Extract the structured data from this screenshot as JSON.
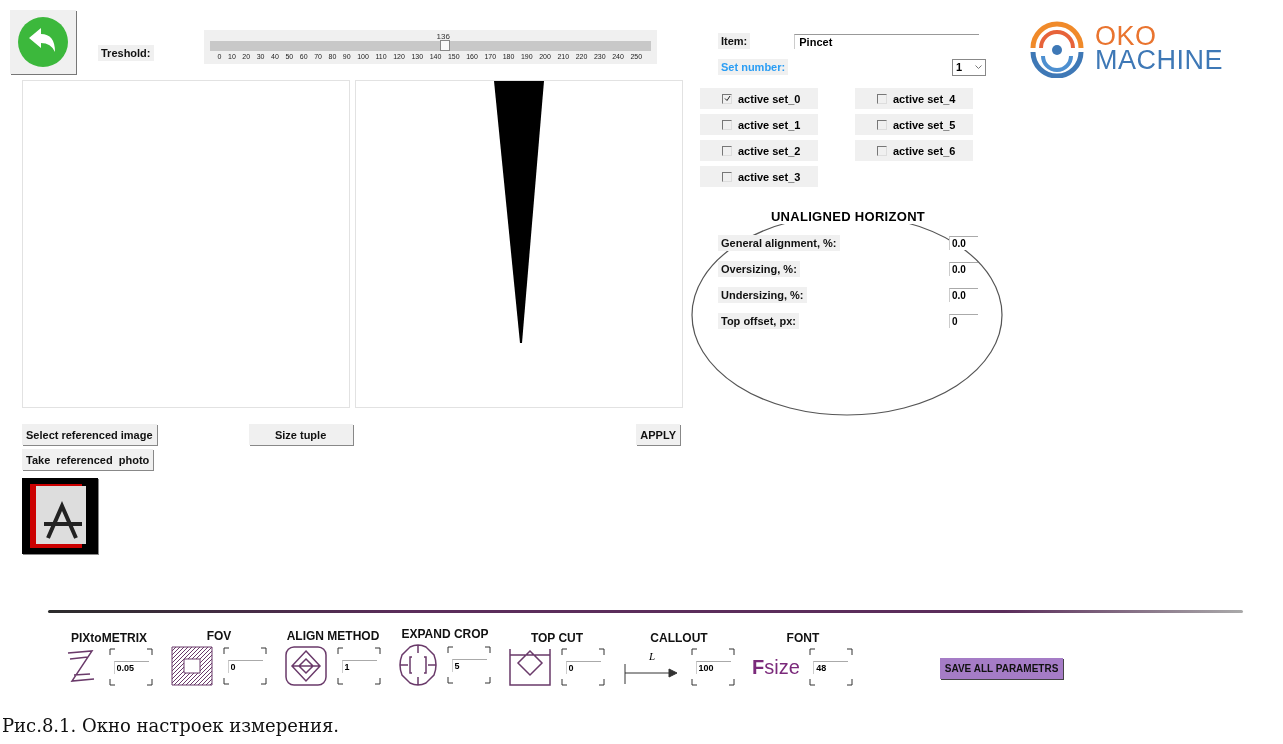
{
  "threshold": {
    "label": "Treshold:",
    "reading": "136",
    "level": 0.533,
    "ticks": [
      "0",
      "10",
      "20",
      "30",
      "40",
      "50",
      "60",
      "70",
      "80",
      "90",
      "100",
      "110",
      "120",
      "130",
      "140",
      "150",
      "160",
      "170",
      "180",
      "190",
      "200",
      "210",
      "220",
      "230",
      "240",
      "250"
    ]
  },
  "item": {
    "label": "Item:",
    "value": "Pincet"
  },
  "set_number": {
    "label": "Set number:",
    "value": "1"
  },
  "logo": {
    "line1": "OKO",
    "line2": "MACHINE"
  },
  "sets": [
    {
      "label": "active set_0",
      "checked": true
    },
    {
      "label": "active set_1",
      "checked": false
    },
    {
      "label": "active set_2",
      "checked": false
    },
    {
      "label": "active set_3",
      "checked": false
    },
    {
      "label": "active set_4",
      "checked": false
    },
    {
      "label": "active set_5",
      "checked": false
    },
    {
      "label": "active set_6",
      "checked": false
    }
  ],
  "unaligned": {
    "title": "UNALIGNED HORIZONT",
    "fields": [
      {
        "label": "General alignment, %:",
        "value": "0.0"
      },
      {
        "label": "Oversizing, %:",
        "value": "0.0"
      },
      {
        "label": "Undersizing, %:",
        "value": "0.0"
      },
      {
        "label": "Top offset, px:",
        "value": "0"
      }
    ]
  },
  "buttons": {
    "select": "Select referenced image",
    "size": "Size tuple",
    "apply": "APPLY",
    "take": "Take  referenced  photo"
  },
  "params": [
    {
      "kind": "pix",
      "title": "PIXtoMETRIX",
      "value": "0.05"
    },
    {
      "kind": "fov",
      "title": "FOV",
      "value": "0"
    },
    {
      "kind": "align",
      "title": "ALIGN METHOD",
      "value": "1"
    },
    {
      "kind": "crop",
      "title": "EXPAND CROP",
      "value": "5"
    },
    {
      "kind": "topcut",
      "title": "TOP CUT",
      "value": "0"
    },
    {
      "kind": "callout",
      "title": "CALLOUT",
      "value": "100",
      "icon_text": "L"
    },
    {
      "kind": "font",
      "title": "FONT",
      "value": "48",
      "icon_text": "**F**size"
    }
  ],
  "save_button": "SAVE ALL PARAMETRS",
  "caption": "Рис.8.1. Окно настроек измерения."
}
